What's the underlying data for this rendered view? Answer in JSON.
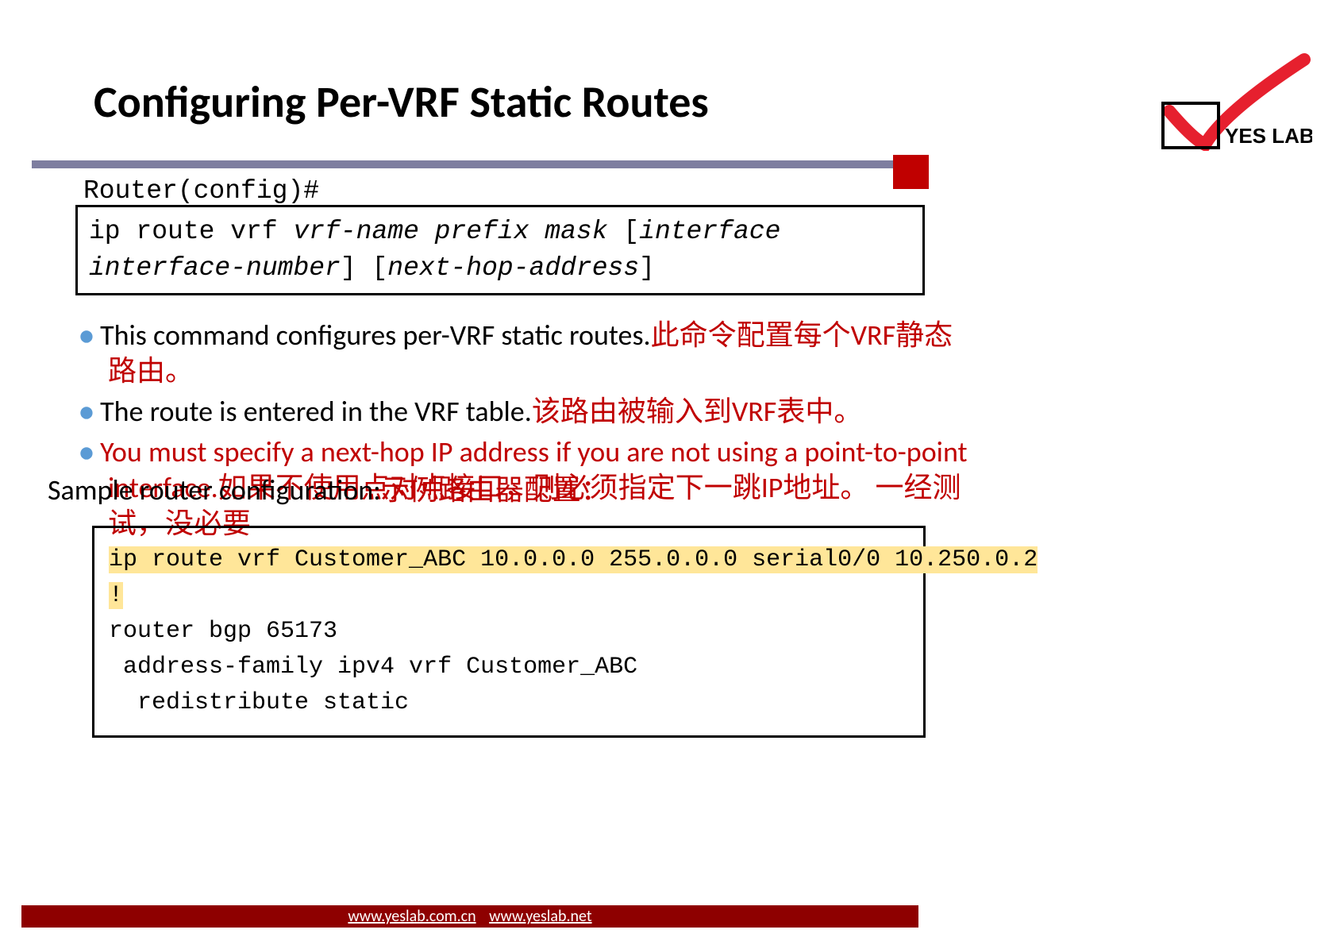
{
  "title": "Configuring Per-VRF Static Routes",
  "logo_text": "YES LAB",
  "router_prompt": "Router(config)#",
  "syntax": {
    "all": "ip route vrf vrf-name prefix mask [interface interface-number] [next-hop-address]",
    "lead": "ip route vrf ",
    "ital1": "vrf-name prefix mask",
    "mid1": " [",
    "ital2": "interface",
    "mid2": "  ",
    "ital3": "interface-number",
    "mid3": "] [",
    "ital4": "next-hop-address",
    "tail": "]"
  },
  "bullets": [
    {
      "en": "This command configures per-VRF static routes.",
      "zh": "此命令配置每个VRF静态路由。",
      "en_class": "black",
      "zh_class": "red"
    },
    {
      "en": "The route is entered in the VRF table.",
      "zh": "该路由被输入到VRF表中。",
      "en_class": "black",
      "zh_class": "red"
    },
    {
      "en": "You must specify a next-hop IP address if you are not using a  point-to-point interface.",
      "zh": "如果不使用点对点接口，则必须指定下一跳IP地址。 一经测试，没必要",
      "en_class": "red",
      "zh_class": "red"
    }
  ],
  "sample_label_en": "Sample router configuration:",
  "sample_label_zh": "示例路由器配置：",
  "code": {
    "line1": "ip route vrf Customer_ABC 10.0.0.0 255.0.0.0 serial0/0 10.250.0.2",
    "line2": "!",
    "line3": "router bgp 65173",
    "line4": " address-family ipv4 vrf Customer_ABC",
    "line5": "  redistribute static"
  },
  "footer": {
    "url1": "www.yeslab.com.cn",
    "url2": "www.yeslab.net"
  }
}
